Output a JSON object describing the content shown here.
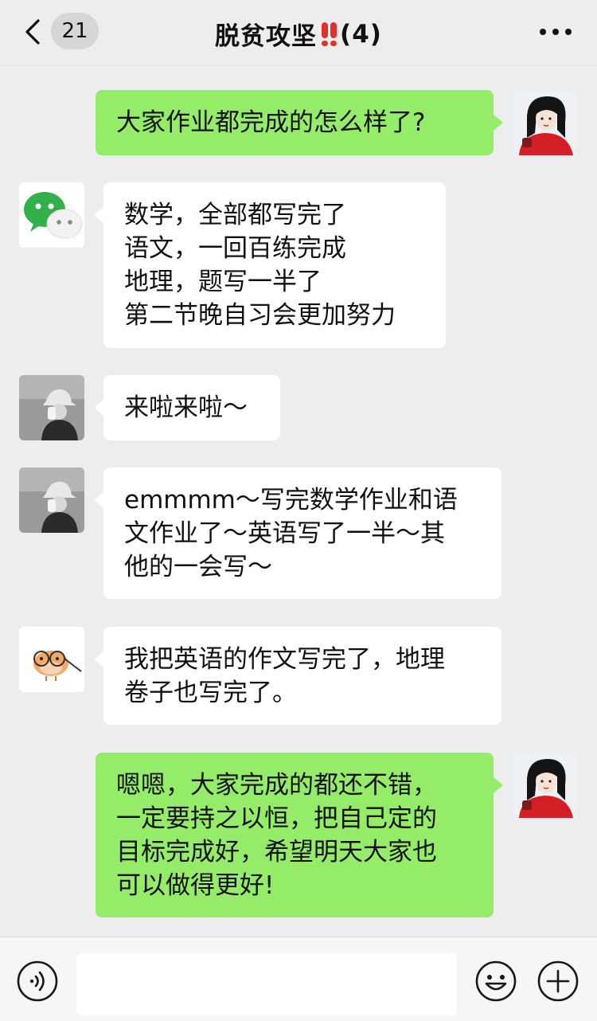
{
  "header": {
    "unread_count": "21",
    "title": "脱贫攻坚",
    "member_count": "(4)"
  },
  "messages": [
    {
      "side": "out",
      "sender": "me",
      "avatar": "girl-red-sweater-avatar",
      "text": "大家作业都完成的怎么样了?"
    },
    {
      "side": "in",
      "sender": "member",
      "avatar": "wechat-logo-avatar",
      "text": "数学，全部都写完了\n语文，一回百练完成\n地理，题写一半了\n第二节晚自习会更加努力"
    },
    {
      "side": "in",
      "sender": "member",
      "avatar": "bucket-hat-person-avatar",
      "text": "来啦来啦～"
    },
    {
      "side": "in",
      "sender": "member",
      "avatar": "bucket-hat-person-avatar",
      "text": "emmmm～写完数学作业和语\n文作业了～英语写了一半～其\n他的一会写～"
    },
    {
      "side": "in",
      "sender": "member",
      "avatar": "bird-glasses-avatar",
      "text": "我把英语的作文写完了，地理\n卷子也写完了。"
    },
    {
      "side": "out",
      "sender": "me",
      "avatar": "girl-red-sweater-avatar",
      "text": "嗯嗯，大家完成的都还不错，\n一定要持之以恒，把自己定的\n目标完成好，希望明天大家也\n可以做得更好!"
    }
  ],
  "input": {
    "value": "",
    "placeholder": ""
  },
  "colors": {
    "background": "#ededed",
    "outgoing_bubble": "#95ec69",
    "incoming_bubble": "#ffffff",
    "title_bang": "#e0322c"
  },
  "icons": [
    "back-chevron-icon",
    "more-dots-icon",
    "voice-icon",
    "emoji-icon",
    "plus-icon"
  ]
}
